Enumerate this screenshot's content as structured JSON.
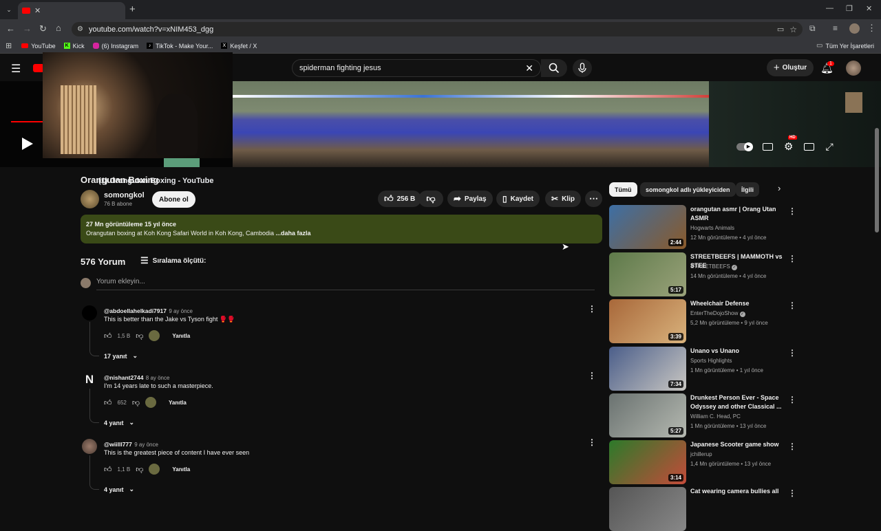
{
  "browser": {
    "tab_title": "(1) Orangutan Boxing - YouTube",
    "url": "youtube.com/watch?v=xNIM453_dgg",
    "bookmarks": [
      "YouTube",
      "Kick",
      "(6) Instagram",
      "TikTok - Make Your...",
      "Keşfet / X"
    ],
    "all_bookmarks": "Tüm Yer İşaretleri"
  },
  "header": {
    "search_query": "spiderman fighting jesus",
    "create_label": "Oluştur",
    "notification_count": "1"
  },
  "video": {
    "hd_badge": "HD"
  },
  "meta": {
    "title": "Orangutan Boxing",
    "channel": "somongkol",
    "subscribers": "76 B abone",
    "subscribe_label": "Abone ol",
    "likes": "256 B",
    "share": "Paylaş",
    "save": "Kaydet",
    "clip": "Klip",
    "views_time": "27 Mn görüntüleme  15 yıl önce",
    "description": "Orangutan boxing at Koh Kong Safari World in Koh Kong, Cambodia",
    "more": "...daha fazla"
  },
  "comments": {
    "count_label": "576 Yorum",
    "sort_label": "Sıralama ölçütü:",
    "add_placeholder": "Yorum ekleyin...",
    "reply_label": "Yanıtla",
    "items": [
      {
        "author": "@abdoellahelkadi7917",
        "time": "9 ay önce",
        "text": "This is better than the Jake vs Tyson fight 🥊🥊",
        "likes": "1,5 B",
        "replies": "17 yanıt"
      },
      {
        "author": "@nishant2744",
        "time": "8 ay önce",
        "text": "I'm 14 years late to such a masterpiece.",
        "likes": "652",
        "replies": "4 yanıt",
        "initial": "N"
      },
      {
        "author": "@wiilll777",
        "time": "9 ay önce",
        "text": "This is the greatest piece of content I have ever seen",
        "likes": "1,1 B",
        "replies": "4 yanıt"
      }
    ]
  },
  "sidebar": {
    "chips": [
      "Tümü",
      "somongkol adlı yükleyiciden",
      "İlgili"
    ],
    "items": [
      {
        "title": "orangutan asmr | Orang Utan ASMR",
        "channel": "Hogwarts Animals",
        "meta": "12 Mn görüntüleme • 4 yıl önce",
        "duration": "2:44",
        "color1": "#3d6fa5",
        "color2": "#8a5a2a"
      },
      {
        "title": "STREETBEEFS | MAMMOTH vs STEE",
        "channel": "STREETBEEFS",
        "verified": true,
        "meta": "14 Mn görüntüleme • 4 yıl önce",
        "duration": "5:17",
        "color1": "#5e7a4a",
        "color2": "#9aa27a"
      },
      {
        "title": "Wheelchair Defense",
        "channel": "EnterTheDojoShow",
        "verified": true,
        "meta": "5,2 Mn görüntüleme • 9 yıl önce",
        "duration": "3:39",
        "color1": "#a8683a",
        "color2": "#d9b27c"
      },
      {
        "title": "Unano vs Unano",
        "channel": "Sports Highlights",
        "meta": "1 Mn görüntüleme • 1 yıl önce",
        "duration": "7:34",
        "color1": "#4b5e8a",
        "color2": "#c9c7c2"
      },
      {
        "title": "Drunkest Person Ever - Space Odyssey and other Classical ...",
        "channel": "William C. Head, PC",
        "meta": "1 Mn görüntüleme • 13 yıl önce",
        "duration": "5:27",
        "color1": "#6a7270",
        "color2": "#b5b9b1"
      },
      {
        "title": "Japanese Scooter game show",
        "channel": "jchillerup",
        "meta": "1,4 Mn görüntüleme • 13 yıl önce",
        "duration": "3:14",
        "color1": "#2c7a2a",
        "color2": "#c44b3a"
      },
      {
        "title": "Cat wearing camera bullies all",
        "channel": "",
        "meta": "",
        "duration": "",
        "color1": "#555",
        "color2": "#888"
      }
    ]
  }
}
